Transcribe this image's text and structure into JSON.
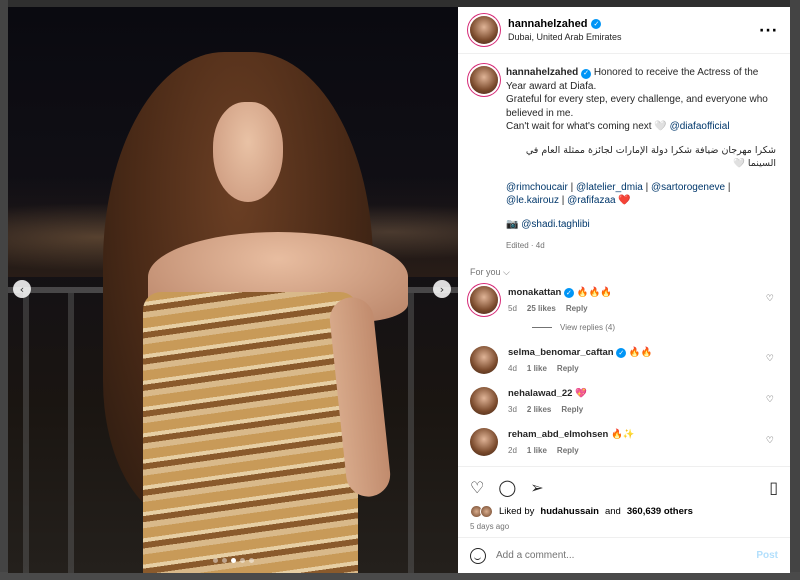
{
  "post": {
    "username": "hannahelzahed",
    "location": "Dubai, United Arab Emirates",
    "caption_lines": [
      "Honored to receive the Actress of the Year award at Diafa.",
      "Grateful for every step, every challenge, and everyone who believed in me.",
      "Can't wait for what's coming next 🤍"
    ],
    "caption_mention": "@diafaofficial",
    "arabic_text": "شكرا مهرجان ضيافة شكرا دولة الإمارات لجائزة ممثلة العام في السينما 🤍",
    "mentions": [
      "@rimchoucair",
      "@latelier_dmia",
      "@sartorogeneve",
      "@le.kairouz",
      "@rafifazaa"
    ],
    "mentions_tail": "❤️",
    "camera_credit": "📷 @shadi.taghlibi",
    "edited": "Edited · 4d"
  },
  "for_you_label": "For you ⌵",
  "comments": [
    {
      "user": "monakattan",
      "text": "🔥🔥🔥",
      "age": "5d",
      "likes": "25 likes",
      "reply": "Reply",
      "verified": true
    },
    {
      "user": "selma_benomar_caftan",
      "text": "🔥🔥",
      "age": "4d",
      "likes": "1 like",
      "reply": "Reply",
      "verified": true
    },
    {
      "user": "nehalawad_22",
      "text": "💖",
      "age": "3d",
      "likes": "2 likes",
      "reply": "Reply",
      "verified": false
    },
    {
      "user": "reham_abd_elmohsen",
      "text": "🔥✨",
      "age": "2d",
      "likes": "1 like",
      "reply": "Reply",
      "verified": false
    }
  ],
  "view_replies": "View replies (4)",
  "likes": {
    "liked_by": "Liked by",
    "user": "hudahussain",
    "and": "and",
    "others": "360,639 others"
  },
  "posted_ago": "5 days ago",
  "add_comment_placeholder": "Add a comment...",
  "post_label": "Post",
  "icons": {
    "more": "more-icon",
    "heart": "heart-icon",
    "comment": "comment-icon",
    "share": "share-icon",
    "save": "bookmark-icon",
    "emoji": "emoji-icon"
  },
  "colors": {
    "verified": "#0095f6",
    "link": "#00376b",
    "post_disabled": "#b2dffc"
  }
}
